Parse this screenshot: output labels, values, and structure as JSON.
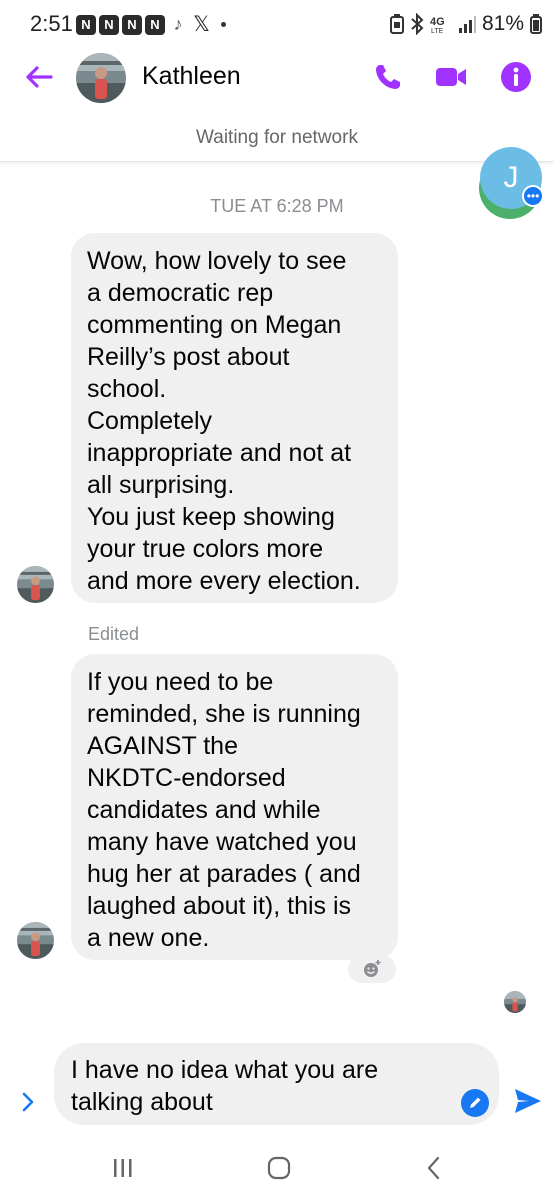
{
  "status_bar": {
    "time": "2:51",
    "notification_icons": [
      "n-icon",
      "n-icon",
      "n-icon",
      "n-icon",
      "tiktok-icon",
      "x-icon"
    ],
    "n_icon_glyph": "N",
    "battery": "81%"
  },
  "header": {
    "contact_name": "Kathleen",
    "accent_color": "#a033ff"
  },
  "network_banner": "Waiting for network",
  "chat_head": {
    "initial": "J"
  },
  "timestamp": "TUE AT 6:28 PM",
  "messages": [
    {
      "lines": [
        "Wow, how lovely to see",
        "a democratic rep",
        "commenting on Megan",
        "Reilly’s post about",
        "school.",
        "Completely",
        "inappropriate and not at",
        "all surprising.",
        "You just keep showing",
        "your true colors more",
        "and more every election."
      ]
    },
    {
      "edited_label": "Edited",
      "lines": [
        "If you need to be",
        "reminded, she is running",
        "AGAINST the",
        "NKDTC-endorsed",
        "candidates and while",
        "many have watched you",
        "hug her at parades ( and",
        "laughed about it), this is",
        "a new one."
      ]
    }
  ],
  "composer": {
    "text": "I have no idea what you are\ntalking about"
  },
  "colors": {
    "bubble_bg": "#f0f0f0",
    "send_blue": "#1877f2",
    "muted_text": "#65676b"
  }
}
